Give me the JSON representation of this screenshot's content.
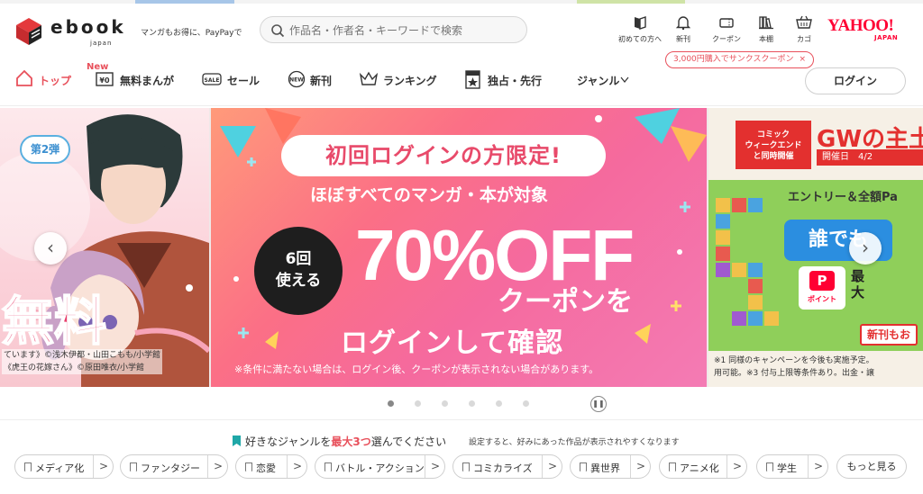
{
  "header": {
    "logo_word": "ebook",
    "logo_sub": "japan",
    "tagline": "マンガもお得に、PayPayで",
    "search_placeholder": "作品名・作者名・キーワードで検索",
    "icons": [
      {
        "label": "初めての方へ",
        "icon": "book-open-icon"
      },
      {
        "label": "新刊",
        "icon": "bell-icon"
      },
      {
        "label": "クーポン",
        "icon": "coupon-icon"
      },
      {
        "label": "本棚",
        "icon": "bookshelf-icon"
      },
      {
        "label": "カゴ",
        "icon": "cart-icon"
      }
    ],
    "yahoo_main": "YAHOO!",
    "yahoo_sub": "JAPAN",
    "coupon_tip": "3,000円購入でサンクスクーポン",
    "coupon_tip_close": "×"
  },
  "nav": {
    "items": [
      {
        "label": "トップ",
        "icon": "home-icon",
        "active": true
      },
      {
        "label": "無料まんが",
        "icon": "free-yen-icon",
        "badge": "New"
      },
      {
        "label": "セール",
        "icon": "sale-icon"
      },
      {
        "label": "新刊",
        "icon": "new-icon"
      },
      {
        "label": "ランキング",
        "icon": "crown-icon"
      },
      {
        "label": "独占・先行",
        "icon": "exclusive-icon"
      },
      {
        "label": "ジャンル",
        "icon": "chevron-down-icon"
      }
    ],
    "login_label": "ログイン"
  },
  "carousel": {
    "main": {
      "pill": "初回ログインの方限定!",
      "sub": "ほぼすべてのマンガ・本が対象",
      "circle_line1": "6回",
      "circle_line2": "使える",
      "big": "70%OFF",
      "coupon": "クーポンを",
      "login_confirm": "ログインして確認",
      "note": "※条件に満たない場合は、ログイン後、クーポンが表示されない場合があります。"
    },
    "left": {
      "dan": "第2弾",
      "free": "無料",
      "credit1": "ています》©浅木伊都・山田こもも/小学館",
      "credit2": "《虎王の花嫁さん》©原田唯衣/小学館"
    },
    "right": {
      "comic_week_1": "コミック",
      "comic_week_2": "ウィークエンド",
      "comic_week_3": "と同時開催",
      "gw": "GWの主土",
      "date": "開催日　4/2",
      "entry": "エントリー＆全額Pa",
      "dare": "誰でも",
      "point_p": "P",
      "point_label": "ポイント",
      "max": "最大",
      "new_also": "新刊もお",
      "note1": "※1 同様のキャンペーンを今後も実施予定。",
      "note2": "用可能。※3 付与上限等条件あり。出金・譲"
    },
    "prev_icon": "‹",
    "next_icon": "›",
    "dots": 6,
    "active_dot": 0
  },
  "genre": {
    "heading_pre": "好きなジャンルを",
    "heading_strong": "最大3つ",
    "heading_post": "選んでください",
    "note": "設定すると、好みにあった作品が表示されやすくなります",
    "chips": [
      "メディア化",
      "ファンタジー",
      "恋愛",
      "バトル・アクション",
      "コミカライズ",
      "異世界",
      "アニメ化",
      "学生"
    ],
    "more": "もっと見る"
  }
}
